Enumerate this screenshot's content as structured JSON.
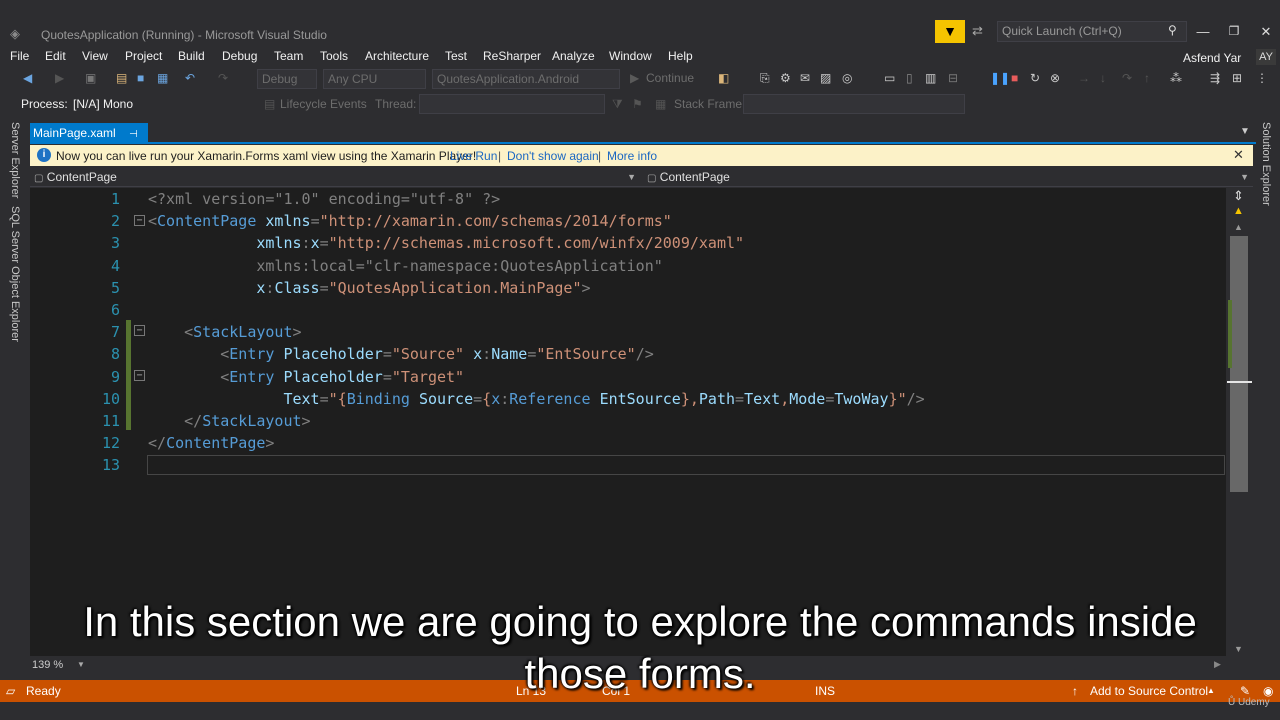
{
  "window": {
    "title": "QuotesApplication (Running) - Microsoft Visual Studio",
    "quick_launch_placeholder": "Quick Launch (Ctrl+Q)"
  },
  "menu": [
    "File",
    "Edit",
    "View",
    "Project",
    "Build",
    "Debug",
    "Team",
    "Tools",
    "Architecture",
    "Test",
    "ReSharper",
    "Analyze",
    "Window",
    "Help"
  ],
  "user": {
    "name": "Asfend Yar",
    "initials": "AY"
  },
  "toolbar": {
    "config": "Debug",
    "platform": "Any CPU",
    "startup_project": "QuotesApplication.Android",
    "continue_label": "Continue"
  },
  "debug_toolbar": {
    "process_label": "Process:",
    "process_value": "[N/A] Mono",
    "lifecycle_events": "Lifecycle Events",
    "thread_label": "Thread:",
    "stack_frame_label": "Stack Frame:"
  },
  "side_tabs": {
    "left": [
      "Server Explorer",
      "SQL Server Object Explorer"
    ],
    "right": [
      "Solution Explorer"
    ]
  },
  "tab": {
    "name": "MainPage.xaml"
  },
  "infobar": {
    "message": "Now you can live run your Xamarin.Forms xaml view using the Xamarin Player!",
    "link_live_run": "Live Run",
    "link_dont_show": "Don't show again",
    "link_more_info": "More info"
  },
  "navbar": {
    "left": "ContentPage",
    "right": "ContentPage"
  },
  "code_lines": [
    [
      [
        "d",
        "<?xml version=\"1.0\" encoding=\"utf-8\" ?>"
      ]
    ],
    [
      [
        "d",
        "<"
      ],
      [
        "e",
        "ContentPage"
      ],
      [
        "t",
        " "
      ],
      [
        "a",
        "xmlns"
      ],
      [
        "d",
        "="
      ],
      [
        "v",
        "\"http://xamarin.com/schemas/2014/forms\""
      ]
    ],
    [
      [
        "t",
        "            "
      ],
      [
        "a",
        "xmlns"
      ],
      [
        "d",
        ":"
      ],
      [
        "a",
        "x"
      ],
      [
        "d",
        "="
      ],
      [
        "v",
        "\"http://schemas.microsoft.com/winfx/2009/xaml\""
      ]
    ],
    [
      [
        "t",
        "            "
      ],
      [
        "d",
        "xmlns:local=\"clr-namespace:QuotesApplication\""
      ]
    ],
    [
      [
        "t",
        "            "
      ],
      [
        "a",
        "x"
      ],
      [
        "d",
        ":"
      ],
      [
        "a",
        "Class"
      ],
      [
        "d",
        "="
      ],
      [
        "v",
        "\"QuotesApplication.MainPage\""
      ],
      [
        "d",
        ">"
      ]
    ],
    [
      [
        "t",
        ""
      ]
    ],
    [
      [
        "t",
        "    "
      ],
      [
        "d",
        "<"
      ],
      [
        "e",
        "StackLayout"
      ],
      [
        "d",
        ">"
      ]
    ],
    [
      [
        "t",
        "        "
      ],
      [
        "d",
        "<"
      ],
      [
        "e",
        "Entry"
      ],
      [
        "t",
        " "
      ],
      [
        "a",
        "Placeholder"
      ],
      [
        "d",
        "="
      ],
      [
        "v",
        "\"Source\""
      ],
      [
        "t",
        " "
      ],
      [
        "a",
        "x"
      ],
      [
        "d",
        ":"
      ],
      [
        "a",
        "Name"
      ],
      [
        "d",
        "="
      ],
      [
        "v",
        "\"EntSource\""
      ],
      [
        "d",
        "/>"
      ]
    ],
    [
      [
        "t",
        "        "
      ],
      [
        "d",
        "<"
      ],
      [
        "e",
        "Entry"
      ],
      [
        "t",
        " "
      ],
      [
        "a",
        "Placeholder"
      ],
      [
        "d",
        "="
      ],
      [
        "v",
        "\"Target\""
      ]
    ],
    [
      [
        "t",
        "               "
      ],
      [
        "a",
        "Text"
      ],
      [
        "d",
        "="
      ],
      [
        "v",
        "\"{"
      ],
      [
        "e",
        "Binding"
      ],
      [
        "t",
        " "
      ],
      [
        "a",
        "Source"
      ],
      [
        "d",
        "="
      ],
      [
        "v",
        "{"
      ],
      [
        "e",
        "x"
      ],
      [
        "d",
        ":"
      ],
      [
        "e",
        "Reference"
      ],
      [
        "t",
        " "
      ],
      [
        "a",
        "EntSource"
      ],
      [
        "v",
        "},"
      ],
      [
        "a",
        "Path"
      ],
      [
        "d",
        "="
      ],
      [
        "a",
        "Text"
      ],
      [
        "v",
        ","
      ],
      [
        "a",
        "Mode"
      ],
      [
        "d",
        "="
      ],
      [
        "a",
        "TwoWay"
      ],
      [
        "v",
        "}\""
      ],
      [
        "d",
        "/>"
      ]
    ],
    [
      [
        "t",
        "    "
      ],
      [
        "d",
        "</"
      ],
      [
        "e",
        "StackLayout"
      ],
      [
        "d",
        ">"
      ]
    ],
    [
      [
        "d",
        "</"
      ],
      [
        "e",
        "ContentPage"
      ],
      [
        "d",
        ">"
      ]
    ],
    [
      [
        "t",
        ""
      ]
    ]
  ],
  "line_numbers": [
    "1",
    "2",
    "3",
    "4",
    "5",
    "6",
    "7",
    "8",
    "9",
    "10",
    "11",
    "12",
    "13"
  ],
  "zoom": "139 %",
  "status": {
    "ready": "Ready",
    "line": "Ln 13",
    "col": "Col 1",
    "mode": "INS",
    "source_control": "Add to Source Control"
  },
  "subtitle": {
    "line1": "In this section we are going to explore the commands inside",
    "line2": "those forms."
  },
  "watermark": "Udemy",
  "colors": {
    "accent": "#007acc",
    "status": "#ca5100",
    "infobar": "#fcf2c8",
    "editor": "#1e1e1e",
    "chrome": "#2d2d30"
  }
}
